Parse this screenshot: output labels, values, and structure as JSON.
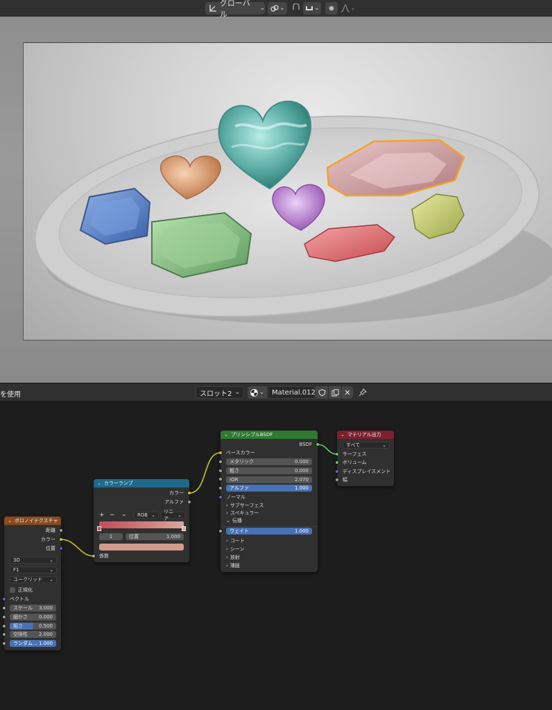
{
  "viewport": {
    "transform_orientation": "グローバル"
  },
  "node_editor": {
    "header_left_text": "を使用",
    "slot": "スロット2",
    "material_name": "Material.012"
  },
  "nodes": {
    "voronoi": {
      "title": "ボロノイテクスチャ",
      "out_distance": "距離",
      "out_color": "カラー",
      "out_position": "位置",
      "dim": "3D",
      "feature": "F1",
      "metric": "ユークリッド",
      "normalize": "正規化",
      "vector": "ベクトル",
      "scale_label": "スケール",
      "scale_value": "3.000",
      "detail_label": "細かさ",
      "detail_value": "0.000",
      "roughness_label": "粗さ",
      "roughness_value": "0.500",
      "lacunarity_label": "空隙性",
      "lacunarity_value": "2.000",
      "randomness_label": "ランダム...",
      "randomness_value": "1.000"
    },
    "colorramp": {
      "title": "カラーランプ",
      "out_color": "カラー",
      "out_alpha": "アルファ",
      "plus": "+",
      "minus": "−",
      "mode": "RGB",
      "interp": "リニア",
      "index": "1",
      "pos_label": "位置",
      "pos_value": "1.000",
      "in_fac": "係数",
      "color_ramp_start": "#c24b57",
      "color_ramp_end": "#d9a79b",
      "selected_color": "#d49a8c"
    },
    "bsdf": {
      "title": "プリンシプルBSDF",
      "out_bsdf": "BSDF",
      "base_color": "ベースカラー",
      "metallic_label": "メタリック",
      "metallic_value": "0.000",
      "roughness_label": "粗さ",
      "roughness_value": "0.000",
      "ior_label": "IOR",
      "ior_value": "2.070",
      "alpha_label": "アルファ",
      "alpha_value": "1.000",
      "normal": "ノーマル",
      "subsurface": "サブサーフェス",
      "specular": "スペキュラー",
      "transmission": "伝播",
      "weight_label": "ウェイト",
      "weight_value": "1.000",
      "coat": "コート",
      "sheen": "シーン",
      "emission": "放射",
      "thin_film": "薄膜"
    },
    "output": {
      "title": "マテリアル出力",
      "target": "すべて",
      "surface": "サーフェス",
      "volume": "ボリューム",
      "displacement": "ディスプレイスメント",
      "thickness": "幅"
    }
  },
  "colors": {
    "voronoi_header": "#8a4a1e",
    "colorramp_header": "#1f6a8a",
    "bsdf_header": "#2f7a30",
    "output_header": "#7c2030",
    "selection_outline": "#f2a22a"
  }
}
